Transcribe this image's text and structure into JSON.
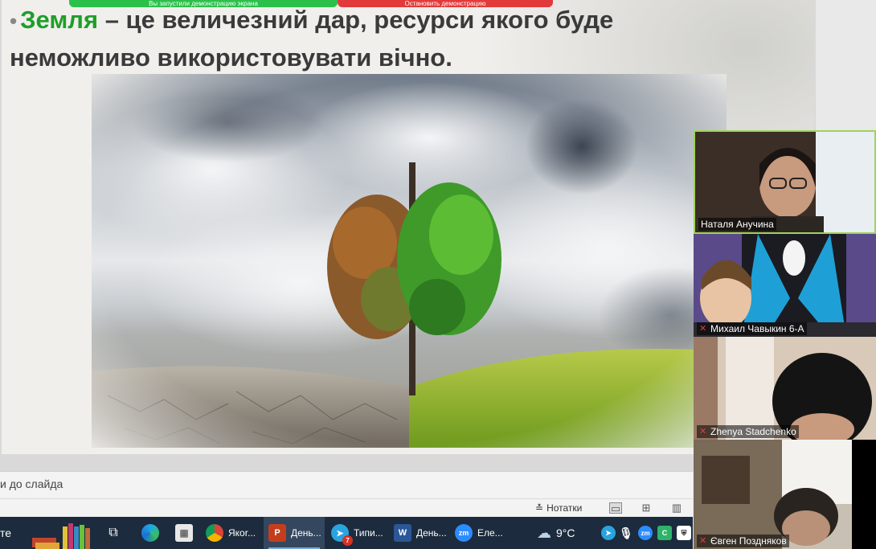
{
  "slide": {
    "highlight_word": "Земля",
    "bullet_rest": " – це величезний дар, ресурси якого буде неможливо використовувати вічно.",
    "screen_share_left": "Вы запустили демонстрацию экрана",
    "screen_share_right": "Остановить демонстрацию"
  },
  "notes": {
    "placeholder": "и до слайда"
  },
  "statusbar": {
    "notes_label": "Нотатки"
  },
  "taskbar": {
    "start_text": "те",
    "apps": [
      {
        "label": "Якоr...",
        "icon": "chrome-icon"
      },
      {
        "label": "День...",
        "icon": "powerpoint-icon",
        "active": true
      },
      {
        "label": "Типи...",
        "icon": "telegram-icon",
        "badge": "7"
      },
      {
        "label": "День...",
        "icon": "word-icon"
      },
      {
        "label": "Еле...",
        "icon": "zoom-icon"
      }
    ],
    "weather": "9°C",
    "tray_badge": "7"
  },
  "participants": [
    {
      "name": "Наталя Анучина",
      "muted": false
    },
    {
      "name": "Михаил Чавыкин 6-А",
      "muted": true
    },
    {
      "name": "Zhenya Stadchenko",
      "muted": true
    },
    {
      "name": "Євген Поздняков",
      "muted": true
    }
  ],
  "colors": {
    "highlight": "#1f9e2a",
    "taskbar": "#1c2b3d",
    "active_speaker": "#9fd35a"
  }
}
